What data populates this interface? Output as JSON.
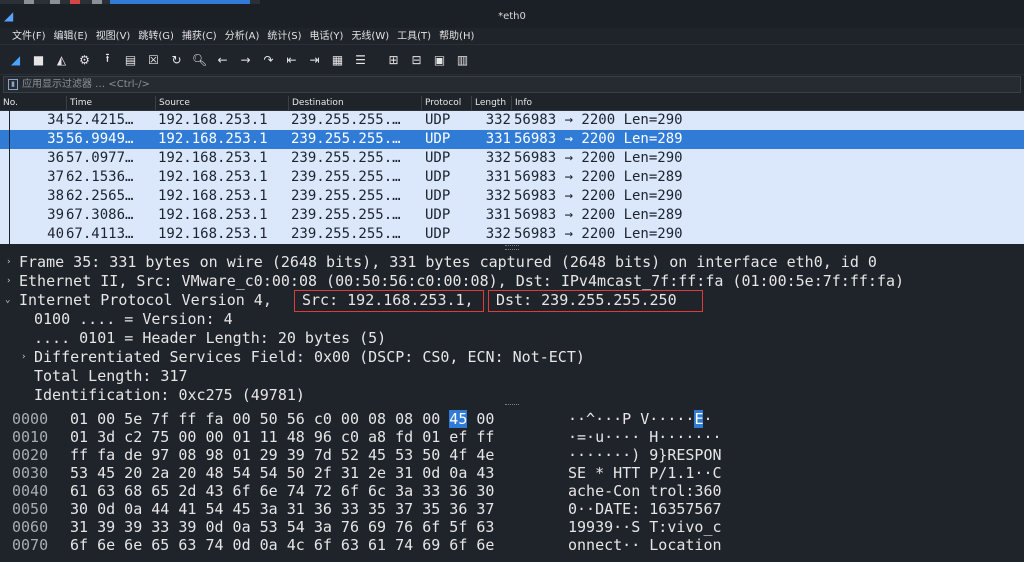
{
  "window": {
    "title": "*eth0"
  },
  "menu": [
    "文件(F)",
    "编辑(E)",
    "视图(V)",
    "跳转(G)",
    "捕获(C)",
    "分析(A)",
    "统计(S)",
    "电话(Y)",
    "无线(W)",
    "工具(T)",
    "帮助(H)"
  ],
  "toolbar": {
    "icons": [
      "shark-fin-start-icon",
      "stop-square-icon",
      "shark-fin-restart-icon",
      "gear-options-icon",
      "open-file-icon",
      "save-file-icon",
      "close-file-icon",
      "reload-icon",
      "search-icon",
      "back-arrow-icon",
      "forward-arrow-icon",
      "go-to-packet-icon",
      "first-packet-icon",
      "last-packet-icon",
      "auto-scroll-icon",
      "colorize-icon",
      "zoom-in-icon",
      "zoom-out-icon",
      "zoom-normal-icon",
      "resize-columns-icon"
    ]
  },
  "filter": {
    "placeholder": "应用显示过滤器 … <Ctrl-/>"
  },
  "packet_list": {
    "columns": [
      "No.",
      "Time",
      "Source",
      "Destination",
      "Protocol",
      "Length",
      "Info"
    ],
    "rows": [
      {
        "no": "34",
        "time": "52.4215…",
        "src": "192.168.253.1",
        "dst": "239.255.255.…",
        "proto": "UDP",
        "len": "332",
        "info": "56983 → 2200 Len=290",
        "selected": false
      },
      {
        "no": "35",
        "time": "56.9949…",
        "src": "192.168.253.1",
        "dst": "239.255.255.…",
        "proto": "UDP",
        "len": "331",
        "info": "56983 → 2200 Len=289",
        "selected": true
      },
      {
        "no": "36",
        "time": "57.0977…",
        "src": "192.168.253.1",
        "dst": "239.255.255.…",
        "proto": "UDP",
        "len": "332",
        "info": "56983 → 2200 Len=290",
        "selected": false
      },
      {
        "no": "37",
        "time": "62.1536…",
        "src": "192.168.253.1",
        "dst": "239.255.255.…",
        "proto": "UDP",
        "len": "331",
        "info": "56983 → 2200 Len=289",
        "selected": false
      },
      {
        "no": "38",
        "time": "62.2565…",
        "src": "192.168.253.1",
        "dst": "239.255.255.…",
        "proto": "UDP",
        "len": "332",
        "info": "56983 → 2200 Len=290",
        "selected": false
      },
      {
        "no": "39",
        "time": "67.3086…",
        "src": "192.168.253.1",
        "dst": "239.255.255.…",
        "proto": "UDP",
        "len": "331",
        "info": "56983 → 2200 Len=289",
        "selected": false
      },
      {
        "no": "40",
        "time": "67.4113…",
        "src": "192.168.253.1",
        "dst": "239.255.255.…",
        "proto": "UDP",
        "len": "332",
        "info": "56983 → 2200 Len=290",
        "selected": false
      }
    ]
  },
  "details": {
    "frame": "Frame 35: 331 bytes on wire (2648 bits), 331 bytes captured (2648 bits) on interface eth0, id 0",
    "ethernet": "Ethernet II, Src: VMware_c0:00:08 (00:50:56:c0:00:08), Dst: IPv4mcast_7f:ff:fa (01:00:5e:7f:ff:fa)",
    "ip_prefix": "Internet Protocol Version 4, ",
    "ip_src": "Src: 192.168.253.1,",
    "ip_dst": "Dst: 239.255.255.250",
    "version": "0100 .... = Version: 4",
    "header_length": ".... 0101 = Header Length: 20 bytes (5)",
    "dsfield": "Differentiated Services Field: 0x00 (DSCP: CS0, ECN: Not-ECT)",
    "total_length": "Total Length: 317",
    "identification": "Identification: 0xc275 (49781)"
  },
  "hex": {
    "rows": [
      {
        "offset": "0000",
        "bytes_a": "01 00 5e 7f ff fa 00 50  56 c0 00 08 08 00 ",
        "sel": "45",
        "bytes_b": " 00",
        "ascii_a": "··^···P V·····",
        "ascii_sel": "E",
        "ascii_b": "·"
      },
      {
        "offset": "0010",
        "bytes_a": "01 3d c2 75 00 00 01 11  48 96 c0 a8 fd 01 ef ff",
        "sel": "",
        "bytes_b": "",
        "ascii_a": "·=·u···· H·······",
        "ascii_sel": "",
        "ascii_b": ""
      },
      {
        "offset": "0020",
        "bytes_a": "ff fa de 97 08 98 01 29  39 7d 52 45 53 50 4f 4e",
        "sel": "",
        "bytes_b": "",
        "ascii_a": "·······) 9}RESPON",
        "ascii_sel": "",
        "ascii_b": ""
      },
      {
        "offset": "0030",
        "bytes_a": "53 45 20 2a 20 48 54 54  50 2f 31 2e 31 0d 0a 43",
        "sel": "",
        "bytes_b": "",
        "ascii_a": "SE * HTT P/1.1··C",
        "ascii_sel": "",
        "ascii_b": ""
      },
      {
        "offset": "0040",
        "bytes_a": "61 63 68 65 2d 43 6f 6e  74 72 6f 6c 3a 33 36 30",
        "sel": "",
        "bytes_b": "",
        "ascii_a": "ache-Con trol:360",
        "ascii_sel": "",
        "ascii_b": ""
      },
      {
        "offset": "0050",
        "bytes_a": "30 0d 0a 44 41 54 45 3a  31 36 33 35 37 35 36 37",
        "sel": "",
        "bytes_b": "",
        "ascii_a": "0··DATE: 16357567",
        "ascii_sel": "",
        "ascii_b": ""
      },
      {
        "offset": "0060",
        "bytes_a": "31 39 39 33 39 0d 0a 53  54 3a 76 69 76 6f 5f 63",
        "sel": "",
        "bytes_b": "",
        "ascii_a": "19939··S T:vivo_c",
        "ascii_sel": "",
        "ascii_b": ""
      },
      {
        "offset": "0070",
        "bytes_a": "6f 6e 6e 65 63 74 0d 0a  4c 6f 63 61 74 69 6f 6e",
        "sel": "",
        "bytes_b": "",
        "ascii_a": "onnect·· Location",
        "ascii_sel": "",
        "ascii_b": ""
      }
    ]
  },
  "colors": {
    "selected_row": "#2f7bd6",
    "row_bg": "#dbe8fb",
    "highlight_box": "#e03b3b",
    "panel_bg": "#1f232a"
  }
}
